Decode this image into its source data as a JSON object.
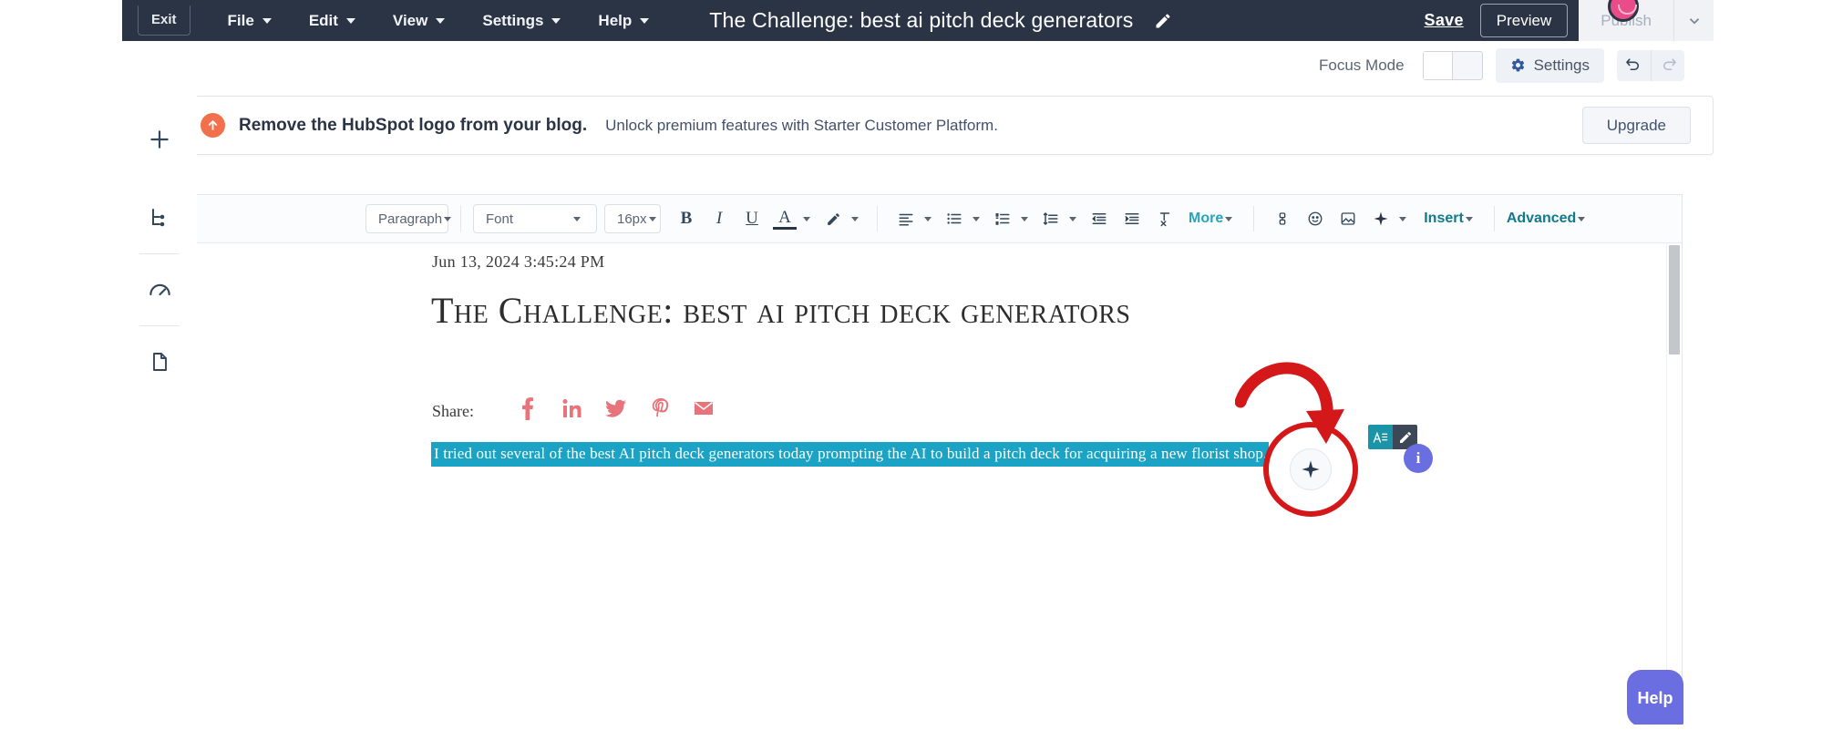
{
  "topbar": {
    "exit_label": "Exit",
    "menus": [
      {
        "label": "File"
      },
      {
        "label": "Edit"
      },
      {
        "label": "View"
      },
      {
        "label": "Settings"
      },
      {
        "label": "Help"
      }
    ],
    "document_title": "The Challenge: best ai pitch deck generators",
    "edit_title_icon": "pencil-icon",
    "save_label": "Save",
    "preview_label": "Preview",
    "publish_label": "Publish",
    "publish_caret_icon": "chevron-down-icon",
    "notification_icon": "notification-dot"
  },
  "subbar": {
    "focus_mode_label": "Focus Mode",
    "focus_mode_state": "off",
    "settings_label": "Settings",
    "settings_icon": "gear-icon",
    "undo_icon": "undo-arrow-icon",
    "redo_icon": "redo-arrow-icon"
  },
  "banner": {
    "icon": "hubspot-sprocket-up-arrow-icon",
    "headline": "Remove the HubSpot logo from your blog.",
    "subtext": "Unlock premium features with Starter Customer Platform.",
    "cta_label": "Upgrade"
  },
  "editor_toolbar": {
    "paragraph_select": "Paragraph",
    "font_select": "Font",
    "size_select": "16px",
    "bold_label": "B",
    "italic_label": "I",
    "underline_label": "U",
    "text_color_label": "A",
    "highlight_icon": "marker-pen-icon",
    "align_icon": "align-left-icon",
    "bullet_list_icon": "bulleted-list-icon",
    "numbered_list_icon": "numbered-list-icon",
    "line_height_icon": "line-spacing-icon",
    "outdent_icon": "decrease-indent-icon",
    "indent_icon": "increase-indent-icon",
    "clear_format_icon": "clear-formatting-icon",
    "more_label": "More",
    "anchor_icon": "anchor-link-icon",
    "emoji_icon": "emoji-smiley-icon",
    "image_icon": "image-icon",
    "sparkle_icon": "ai-sparkle-icon",
    "insert_label": "Insert",
    "advanced_label": "Advanced"
  },
  "document": {
    "date": "Jun 13, 2024 3:45:24 PM",
    "title": "The Challenge: best ai pitch deck generators",
    "share_label": "Share:",
    "share_icons": [
      {
        "name": "facebook-icon",
        "glyph": "f"
      },
      {
        "name": "linkedin-icon",
        "glyph": "in"
      },
      {
        "name": "twitter-icon",
        "glyph": "✈"
      },
      {
        "name": "pinterest-icon",
        "glyph": "P"
      },
      {
        "name": "email-icon",
        "glyph": "✉"
      }
    ],
    "selected_paragraph": "I tried out several of the best AI pitch deck generators today prompting the AI to build a pitch deck for acquiring a new florist shop."
  },
  "annotation": {
    "arrow_color": "#d4181a",
    "circle_color": "#d4181a",
    "target": "ai-assistant-sparkle-button"
  },
  "floating_toolbar": {
    "text_styles_icon": "text-styles-icon",
    "edit_icon": "pencil-edit-icon",
    "info_badge_label": "i"
  },
  "sidebar": {
    "items": [
      {
        "name": "add-module-icon",
        "label": "Add"
      },
      {
        "name": "content-tree-icon",
        "label": "Content tree"
      },
      {
        "name": "optimize-gauge-icon",
        "label": "Optimize"
      },
      {
        "name": "document-icon",
        "label": "Document"
      }
    ]
  },
  "help": {
    "label": "Help"
  },
  "colors": {
    "topbar_bg": "#2b3445",
    "accent_teal": "#1aa3c4",
    "annotation_red": "#d4181a",
    "help_purple": "#6b6ee0",
    "social_coral": "#e8737a",
    "hubspot_orange": "#f2714c"
  }
}
